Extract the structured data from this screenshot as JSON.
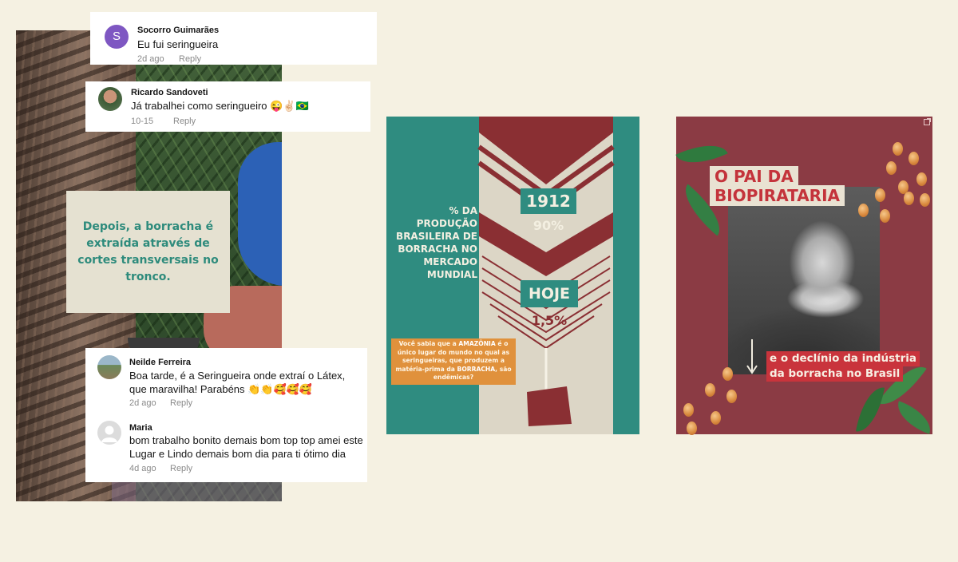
{
  "left_post": {
    "caption": "Depois, a borracha é extraída através de cortes transversais no tronco."
  },
  "comments": [
    {
      "avatar_letter": "S",
      "name": "Socorro Guimarães",
      "text": "Eu fui seringueira",
      "time": "2d ago",
      "reply": "Reply"
    },
    {
      "name": "Ricardo Sandoveti",
      "text": "Já trabalhei como seringueiro 😜✌🏻🇧🇷",
      "time": "10-15",
      "reply": "Reply"
    },
    {
      "name": "Neilde Ferreira",
      "text": "Boa tarde, é a Seringueira onde extraí o Látex, que maravilha! Parabéns 👏👏🥰🥰🥰",
      "time": "2d ago",
      "reply": "Reply"
    },
    {
      "name": "Maria",
      "text": "bom trabalho bonito demais bom top top amei este Lugar e Lindo demais bom dia para ti ótimo dia",
      "time": "4d ago",
      "reply": "Reply"
    }
  ],
  "infographic": {
    "side_text": "% DA PRODUÇÃO BRASILEIRA DE BORRACHA NO MERCADO MUNDIAL",
    "year": "1912",
    "year_pct": "90%",
    "today": "HOJE",
    "today_pct": "1,5%",
    "note_prefix": "Você sabia que a ",
    "note_highlight1": "AMAZÔNIA",
    "note_middle": " é o único lugar do mundo no qual as seringueiras, que produzem a matéria-prima da ",
    "note_highlight2": "BORRACHA",
    "note_suffix": ", são endêmicas?",
    "colors": {
      "teal": "#2f8c80",
      "wine": "#8a2f33",
      "cream": "#dcd6c6",
      "orange": "#e0913c"
    }
  },
  "poster": {
    "title_line1": "O PAI DA",
    "title_line2": "BIOPIRATARIA",
    "subtitle_line1": "e o declínio da indústria",
    "subtitle_line2": "da borracha no Brasil",
    "colors": {
      "background": "#8b3b44",
      "title_bg": "#e9e2d2",
      "title_text": "#c4333b",
      "subtitle_bg": "#c9343c"
    }
  }
}
